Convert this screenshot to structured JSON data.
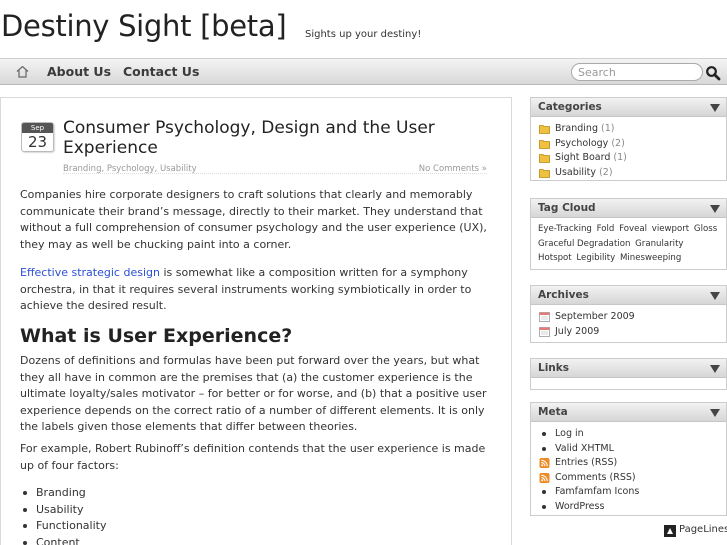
{
  "header": {
    "site_title": "Destiny Sight [beta]",
    "tagline": "Sights up your destiny!"
  },
  "nav": {
    "home_icon": "home-icon",
    "items": [
      {
        "label": "About Us"
      },
      {
        "label": "Contact Us"
      }
    ],
    "search": {
      "placeholder": "Search",
      "value": "",
      "icon": "magnifier-icon"
    }
  },
  "post": {
    "date": {
      "month": "Sep",
      "day": "23"
    },
    "title": "Consumer Psychology, Design and the User Experience",
    "categories": "Branding, Psychology, Usability",
    "comments": "No Comments »",
    "paragraphs": [
      {
        "text": "Companies hire corporate designers to craft solutions that clearly and memorably communicate their brand’s message, directly to their market. They understand that without a full comprehension of consumer psychology and the user experience (UX), they may as well be chucking paint into a corner."
      },
      {
        "link_text": "Effective strategic design",
        "text": " is somewhat like a composition written for a symphony orchestra, in that it requires several instruments working symbiotically in order to achieve the desired result."
      },
      {
        "text": "Dozens of definitions and formulas have been put forward over the years, but what they all have in common are the premises that (a) the customer experience is the ultimate loyalty/sales motivator – for better or for worse, and (b) that a positive user experience depends on the correct ratio of a number of different elements. It is only the labels given those elements that differ between theories."
      },
      {
        "text": "For example, Robert Rubinoff’s definition contends that the user experience is made up of four factors:"
      }
    ],
    "heading": "What is User Experience?",
    "list": [
      "Branding",
      "Usability",
      "Functionality",
      "Content"
    ]
  },
  "sidebar": {
    "categories": {
      "title": "Categories",
      "items": [
        {
          "label": "Branding",
          "count": "(1)"
        },
        {
          "label": "Psychology",
          "count": "(2)"
        },
        {
          "label": "Sight Board",
          "count": "(1)"
        },
        {
          "label": "Usability",
          "count": "(2)"
        }
      ]
    },
    "tag_cloud": {
      "title": "Tag Cloud",
      "tags": [
        "Eye-Tracking",
        "Fold",
        "Foveal",
        "viewport",
        "Gloss",
        "Graceful Degradation",
        "Granularity",
        "Hotspot",
        "Legibility",
        "Minesweeping"
      ]
    },
    "archives": {
      "title": "Archives",
      "items": [
        {
          "label": "September 2009"
        },
        {
          "label": "July 2009"
        }
      ]
    },
    "links": {
      "title": "Links"
    },
    "meta": {
      "title": "Meta",
      "items": [
        {
          "label": "Log in",
          "icon": "bullet"
        },
        {
          "label": "Valid XHTML",
          "icon": "bullet"
        },
        {
          "label": "Entries (RSS)",
          "icon": "rss-icon"
        },
        {
          "label": "Comments (RSS)",
          "icon": "rss-icon"
        },
        {
          "label": "Famfamfam Icons",
          "icon": "bullet"
        },
        {
          "label": "WordPress",
          "icon": "bullet"
        }
      ]
    }
  },
  "footer": {
    "credit": "PageLines"
  },
  "colors": {
    "link": "#2b4fd1",
    "folder": "#f0c040",
    "rss": "#f08a24"
  }
}
